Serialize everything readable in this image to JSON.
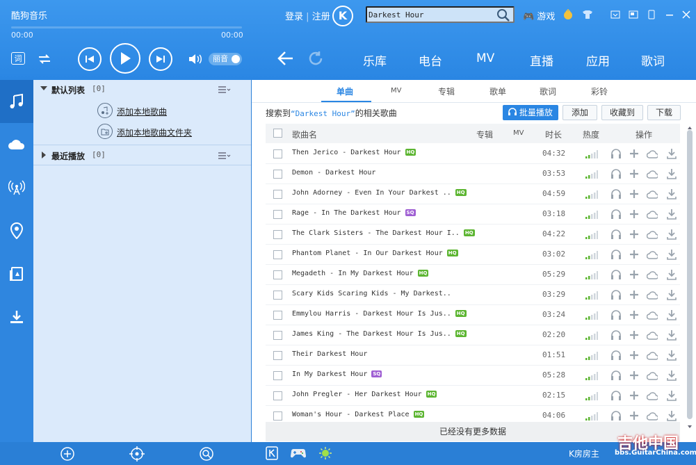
{
  "app": {
    "title": "酷狗音乐",
    "time_elapsed": "00:00",
    "time_total": "00:00",
    "volume_mode": "丽音"
  },
  "header": {
    "login": "登录",
    "register": "注册",
    "logo": "K",
    "search_value": "Darkest Hour",
    "games": "游戏",
    "nav_tabs": [
      "乐库",
      "电台",
      "MV",
      "直播",
      "应用",
      "歌词"
    ]
  },
  "playlists": [
    {
      "name": "默认列表",
      "count": "[0]"
    },
    {
      "name": "最近播放",
      "count": "[0]"
    }
  ],
  "playlist_actions": {
    "add_song": "添加本地歌曲",
    "add_folder": "添加本地歌曲文件夹"
  },
  "sub_tabs": [
    "单曲",
    "MV",
    "专辑",
    "歌单",
    "歌词",
    "彩铃"
  ],
  "search_result": {
    "prefix": "搜索到",
    "keyword": "“Darkest Hour”",
    "suffix": "的相关歌曲"
  },
  "actions": {
    "batch_play": "批量播放",
    "add": "添加",
    "collect": "收藏到",
    "download": "下载"
  },
  "columns": {
    "name": "歌曲名",
    "album": "专辑",
    "mv": "MV",
    "duration": "时长",
    "heat": "热度",
    "ops": "操作"
  },
  "songs": [
    {
      "title": "Then Jerico - Darkest Hour",
      "badge": "HQ",
      "duration": "04:32"
    },
    {
      "title": "Demon - Darkest Hour",
      "badge": "",
      "duration": "03:53"
    },
    {
      "title": "John Adorney - Even In Your Darkest ..",
      "badge": "HQ",
      "duration": "04:59"
    },
    {
      "title": "Rage - In The Darkest Hour",
      "badge": "SQ",
      "duration": "03:18"
    },
    {
      "title": "The Clark Sisters - The Darkest Hour I..",
      "badge": "HQ",
      "duration": "04:22"
    },
    {
      "title": "Phantom Planet - In Our Darkest Hour",
      "badge": "HQ",
      "duration": "03:02"
    },
    {
      "title": "Megadeth - In My Darkest Hour",
      "badge": "HQ",
      "duration": "05:29"
    },
    {
      "title": "Scary Kids Scaring Kids - My Darkest..",
      "badge": "",
      "duration": "03:29"
    },
    {
      "title": "Emmylou Harris - Darkest Hour Is Jus..",
      "badge": "HQ",
      "duration": "03:24"
    },
    {
      "title": "James King - The Darkest Hour Is Jus..",
      "badge": "HQ",
      "duration": "02:20"
    },
    {
      "title": "Their Darkest Hour",
      "badge": "",
      "duration": "01:51"
    },
    {
      "title": "In My Darkest Hour",
      "badge": "SQ",
      "duration": "05:28"
    },
    {
      "title": "John Pregler - Her Darkest Hour",
      "badge": "HQ",
      "duration": "02:15"
    },
    {
      "title": "Woman's Hour - Darkest Place",
      "badge": "HQ",
      "duration": "04:06"
    }
  ],
  "no_more": "已经没有更多数据",
  "bottom": {
    "status_text": "K房房主",
    "watermark_big": "吉他中国",
    "watermark_url": "bbs.GuitarChina.com"
  },
  "colors": {
    "brand_blue": "#2a86e3",
    "hq_badge": "#5cb531",
    "sq_badge": "#9f5fd3"
  }
}
